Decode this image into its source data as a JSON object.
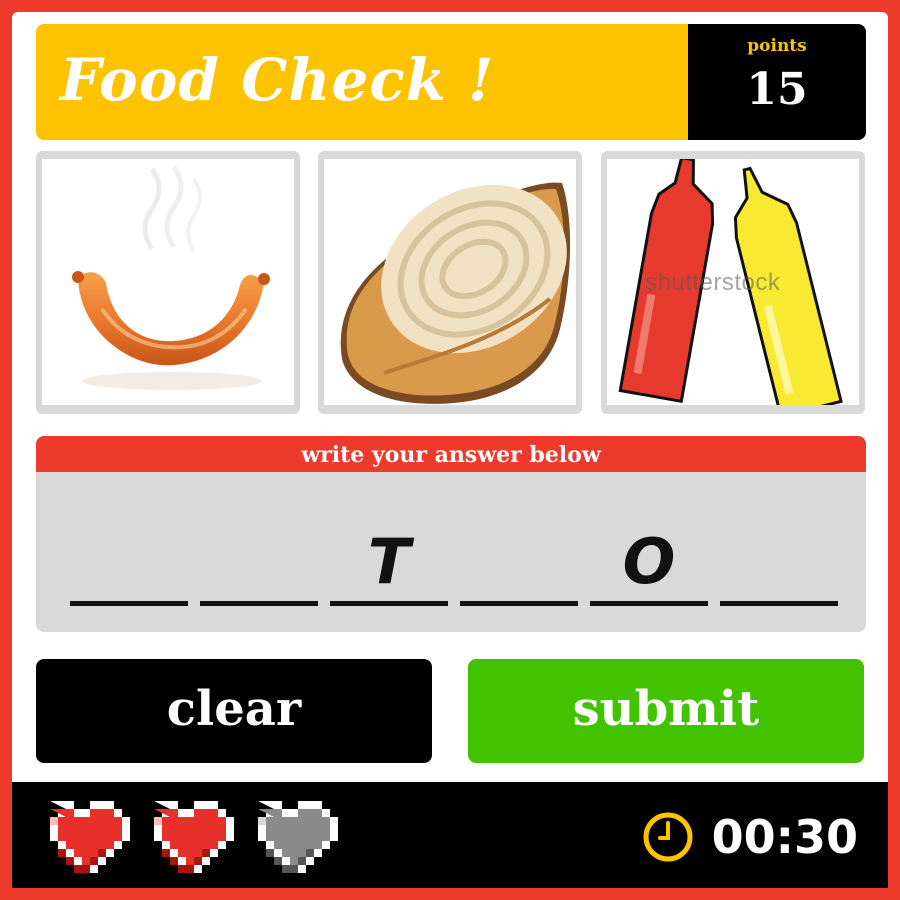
{
  "header": {
    "title": "Food Check !",
    "points_label": "points",
    "points_value": "15"
  },
  "pictures": [
    {
      "name": "sausage",
      "watermark": ""
    },
    {
      "name": "onion",
      "watermark": ""
    },
    {
      "name": "ketchup and mustard",
      "watermark": "shutterstock"
    }
  ],
  "answer": {
    "prompt": "write your answer below",
    "slots": [
      "",
      "",
      "T",
      "",
      "O",
      ""
    ]
  },
  "buttons": {
    "clear_label": "clear",
    "submit_label": "submit"
  },
  "footer": {
    "lives": [
      {
        "state": "full",
        "color": "#e8302a"
      },
      {
        "state": "full",
        "color": "#e8302a"
      },
      {
        "state": "empty",
        "color": "#8a8a8a"
      }
    ],
    "timer_icon": "clock-icon",
    "timer": "00:30"
  },
  "colors": {
    "accent": "#fec300",
    "frame": "#ee3a2c",
    "submit": "#43c200"
  }
}
